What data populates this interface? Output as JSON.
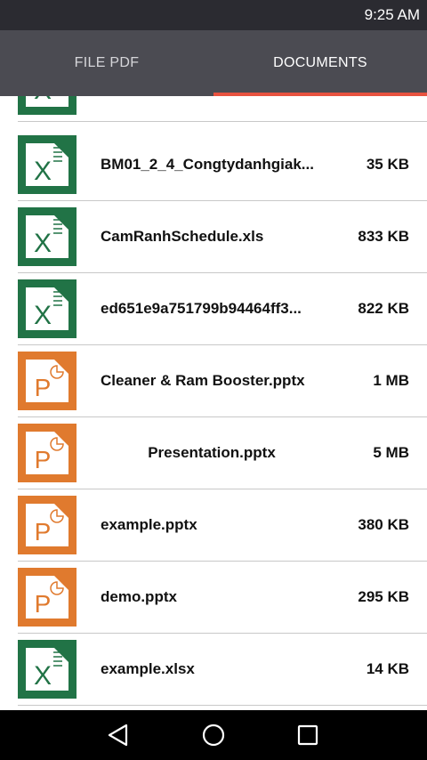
{
  "status": {
    "time": "9:25 AM"
  },
  "tabs": [
    {
      "label": "FILE PDF"
    },
    {
      "label": "DOCUMENTS"
    }
  ],
  "colors": {
    "excel": "#217346",
    "powerpoint": "#e07a2e",
    "accent": "#e8523f"
  },
  "files": [
    {
      "name": "BM01_2_4_Congtydanhgiak...",
      "size": "35 KB",
      "type": "excel-icon"
    },
    {
      "name": "CamRanhSchedule.xls",
      "size": "833 KB",
      "type": "excel-icon"
    },
    {
      "name": "ed651e9a751799b94464ff3...",
      "size": "822 KB",
      "type": "excel-icon"
    },
    {
      "name": "Cleaner & Ram Booster.pptx",
      "size": "1 MB",
      "type": "powerpoint-icon"
    },
    {
      "name": "Presentation.pptx",
      "size": "5 MB",
      "type": "powerpoint-icon"
    },
    {
      "name": "example.pptx",
      "size": "380 KB",
      "type": "powerpoint-icon"
    },
    {
      "name": "demo.pptx",
      "size": "295 KB",
      "type": "powerpoint-icon"
    },
    {
      "name": "example.xlsx",
      "size": "14 KB",
      "type": "excel-icon"
    }
  ]
}
